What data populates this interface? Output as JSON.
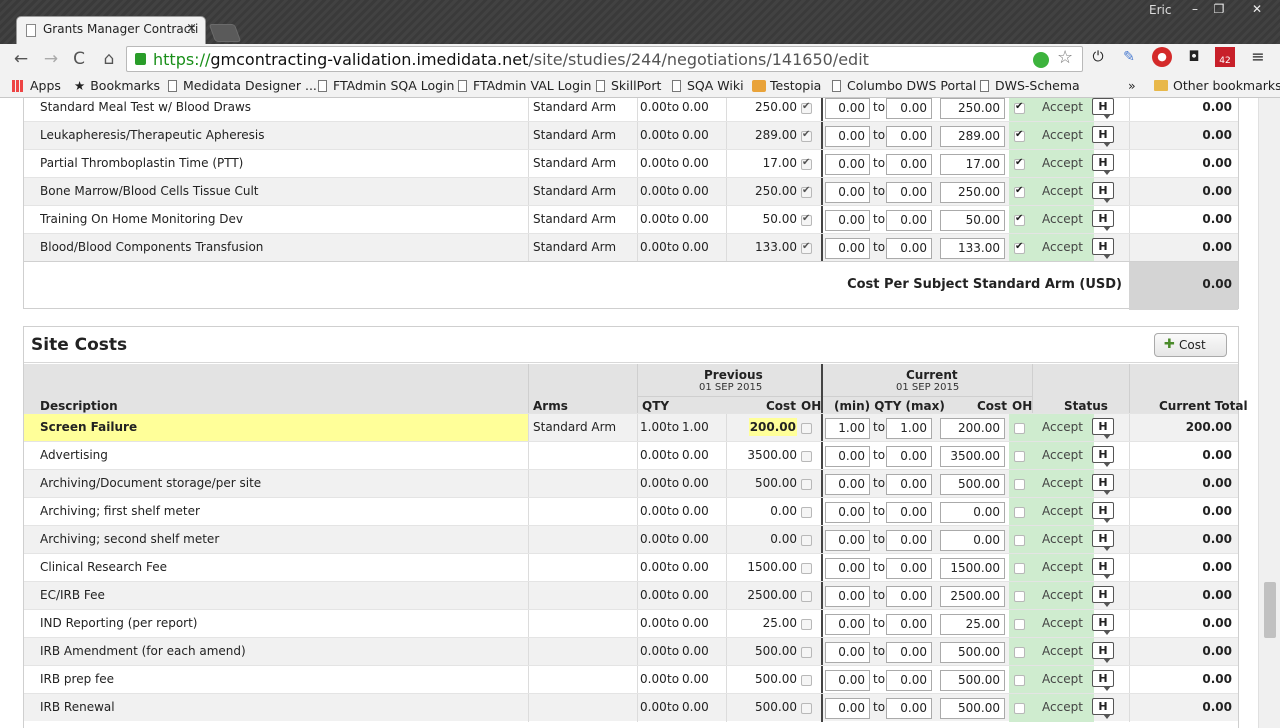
{
  "browser": {
    "tab_title": "Grants Manager Contracti",
    "tab_close": "×",
    "window_user": "Eric",
    "window_controls": [
      "–",
      "❐",
      "✕"
    ],
    "url_scheme": "https://",
    "url_host": "gmcontracting-validation.imedidata.net",
    "url_path": "/site/studies/244/negotiations/141650/edit",
    "nav": {
      "back": "←",
      "forward": "→",
      "reload": "C",
      "home": "⌂"
    },
    "bookmarks": [
      {
        "label": "Apps",
        "icon": "apps-grid-icon"
      },
      {
        "label": "Bookmarks",
        "icon": "star-icon"
      },
      {
        "label": "Medidata Designer ...",
        "icon": "page-icon"
      },
      {
        "label": "FTAdmin SQA Login",
        "icon": "page-icon"
      },
      {
        "label": "FTAdmin VAL Login",
        "icon": "page-icon"
      },
      {
        "label": "SkillPort",
        "icon": "page-icon"
      },
      {
        "label": "SQA Wiki",
        "icon": "page-icon"
      },
      {
        "label": "Testopia",
        "icon": "testopia-icon"
      },
      {
        "label": "Columbo DWS Portal",
        "icon": "page-icon"
      },
      {
        "label": "DWS-Schema",
        "icon": "page-icon"
      }
    ],
    "bookmarks_overflow": "»",
    "other_bookmarks": "Other bookmarks",
    "extension_badge": "42"
  },
  "arm_costs": {
    "rows": [
      {
        "desc": "Standard Meal Test w/ Blood Draws",
        "arm": "Standard Arm",
        "prev_qty_min": "0.00",
        "prev_to": "to",
        "prev_qty_max": "0.00",
        "prev_cost": "250.00",
        "cur_min": "0.00",
        "to": "to",
        "cur_max": "0.00",
        "cur_cost": "250.00",
        "status": "Accept",
        "h": "H",
        "total": "0.00"
      },
      {
        "desc": "Leukapheresis/Therapeutic Apheresis",
        "arm": "Standard Arm",
        "prev_qty_min": "0.00",
        "prev_to": "to",
        "prev_qty_max": "0.00",
        "prev_cost": "289.00",
        "cur_min": "0.00",
        "to": "to",
        "cur_max": "0.00",
        "cur_cost": "289.00",
        "status": "Accept",
        "h": "H",
        "total": "0.00"
      },
      {
        "desc": "Partial Thromboplastin Time (PTT)",
        "arm": "Standard Arm",
        "prev_qty_min": "0.00",
        "prev_to": "to",
        "prev_qty_max": "0.00",
        "prev_cost": "17.00",
        "cur_min": "0.00",
        "to": "to",
        "cur_max": "0.00",
        "cur_cost": "17.00",
        "status": "Accept",
        "h": "H",
        "total": "0.00"
      },
      {
        "desc": "Bone Marrow/Blood Cells Tissue Cult",
        "arm": "Standard Arm",
        "prev_qty_min": "0.00",
        "prev_to": "to",
        "prev_qty_max": "0.00",
        "prev_cost": "250.00",
        "cur_min": "0.00",
        "to": "to",
        "cur_max": "0.00",
        "cur_cost": "250.00",
        "status": "Accept",
        "h": "H",
        "total": "0.00"
      },
      {
        "desc": "Training On Home Monitoring Dev",
        "arm": "Standard Arm",
        "prev_qty_min": "0.00",
        "prev_to": "to",
        "prev_qty_max": "0.00",
        "prev_cost": "50.00",
        "cur_min": "0.00",
        "to": "to",
        "cur_max": "0.00",
        "cur_cost": "50.00",
        "status": "Accept",
        "h": "H",
        "total": "0.00"
      },
      {
        "desc": "Blood/Blood Components Transfusion",
        "arm": "Standard Arm",
        "prev_qty_min": "0.00",
        "prev_to": "to",
        "prev_qty_max": "0.00",
        "prev_cost": "133.00",
        "cur_min": "0.00",
        "to": "to",
        "cur_max": "0.00",
        "cur_cost": "133.00",
        "status": "Accept",
        "h": "H",
        "total": "0.00"
      }
    ],
    "cost_per_subject_label": "Cost Per Subject Standard Arm (USD)",
    "cost_per_subject_value": "0.00"
  },
  "site_costs": {
    "title": "Site Costs",
    "add_cost_label": "Cost",
    "headers": {
      "description": "Description",
      "arms": "Arms",
      "previous": "Previous",
      "previous_date": "01 SEP 2015",
      "current": "Current",
      "current_date": "01 SEP 2015",
      "qty": "QTY",
      "cost": "Cost",
      "oh": "OH",
      "cur_qty": "(min) QTY (max)",
      "cur_cost": "Cost",
      "cur_oh": "OH",
      "status": "Status",
      "current_total": "Current Total"
    },
    "rows": [
      {
        "desc": "Screen Failure",
        "arm": "Standard Arm",
        "prev_qty_min": "1.00",
        "prev_to": "to",
        "prev_qty_max": "1.00",
        "prev_cost": "200.00",
        "cur_min": "1.00",
        "to": "to",
        "cur_max": "1.00",
        "cur_cost": "200.00",
        "status": "Accept",
        "h": "H",
        "total": "200.00"
      },
      {
        "desc": "Advertising",
        "arm": "",
        "prev_qty_min": "0.00",
        "prev_to": "to",
        "prev_qty_max": "0.00",
        "prev_cost": "3500.00",
        "cur_min": "0.00",
        "to": "to",
        "cur_max": "0.00",
        "cur_cost": "3500.00",
        "status": "Accept",
        "h": "H",
        "total": "0.00"
      },
      {
        "desc": "Archiving/Document storage/per site",
        "arm": "",
        "prev_qty_min": "0.00",
        "prev_to": "to",
        "prev_qty_max": "0.00",
        "prev_cost": "500.00",
        "cur_min": "0.00",
        "to": "to",
        "cur_max": "0.00",
        "cur_cost": "500.00",
        "status": "Accept",
        "h": "H",
        "total": "0.00"
      },
      {
        "desc": "Archiving; first shelf meter",
        "arm": "",
        "prev_qty_min": "0.00",
        "prev_to": "to",
        "prev_qty_max": "0.00",
        "prev_cost": "0.00",
        "cur_min": "0.00",
        "to": "to",
        "cur_max": "0.00",
        "cur_cost": "0.00",
        "status": "Accept",
        "h": "H",
        "total": "0.00"
      },
      {
        "desc": "Archiving; second shelf meter",
        "arm": "",
        "prev_qty_min": "0.00",
        "prev_to": "to",
        "prev_qty_max": "0.00",
        "prev_cost": "0.00",
        "cur_min": "0.00",
        "to": "to",
        "cur_max": "0.00",
        "cur_cost": "0.00",
        "status": "Accept",
        "h": "H",
        "total": "0.00"
      },
      {
        "desc": "Clinical Research Fee",
        "arm": "",
        "prev_qty_min": "0.00",
        "prev_to": "to",
        "prev_qty_max": "0.00",
        "prev_cost": "1500.00",
        "cur_min": "0.00",
        "to": "to",
        "cur_max": "0.00",
        "cur_cost": "1500.00",
        "status": "Accept",
        "h": "H",
        "total": "0.00"
      },
      {
        "desc": "EC/IRB Fee",
        "arm": "",
        "prev_qty_min": "0.00",
        "prev_to": "to",
        "prev_qty_max": "0.00",
        "prev_cost": "2500.00",
        "cur_min": "0.00",
        "to": "to",
        "cur_max": "0.00",
        "cur_cost": "2500.00",
        "status": "Accept",
        "h": "H",
        "total": "0.00"
      },
      {
        "desc": "IND Reporting (per report)",
        "arm": "",
        "prev_qty_min": "0.00",
        "prev_to": "to",
        "prev_qty_max": "0.00",
        "prev_cost": "25.00",
        "cur_min": "0.00",
        "to": "to",
        "cur_max": "0.00",
        "cur_cost": "25.00",
        "status": "Accept",
        "h": "H",
        "total": "0.00"
      },
      {
        "desc": "IRB Amendment (for each amend)",
        "arm": "",
        "prev_qty_min": "0.00",
        "prev_to": "to",
        "prev_qty_max": "0.00",
        "prev_cost": "500.00",
        "cur_min": "0.00",
        "to": "to",
        "cur_max": "0.00",
        "cur_cost": "500.00",
        "status": "Accept",
        "h": "H",
        "total": "0.00"
      },
      {
        "desc": "IRB prep fee",
        "arm": "",
        "prev_qty_min": "0.00",
        "prev_to": "to",
        "prev_qty_max": "0.00",
        "prev_cost": "500.00",
        "cur_min": "0.00",
        "to": "to",
        "cur_max": "0.00",
        "cur_cost": "500.00",
        "status": "Accept",
        "h": "H",
        "total": "0.00"
      },
      {
        "desc": "IRB Renewal",
        "arm": "",
        "prev_qty_min": "0.00",
        "prev_to": "to",
        "prev_qty_max": "0.00",
        "prev_cost": "500.00",
        "cur_min": "0.00",
        "to": "to",
        "cur_max": "0.00",
        "cur_cost": "500.00",
        "status": "Accept",
        "h": "H",
        "total": "0.00"
      }
    ]
  },
  "colors": {
    "current_green": "#cfeccf",
    "highlight_yellow": "#ffff99",
    "total_gray": "#d4d4d4"
  }
}
